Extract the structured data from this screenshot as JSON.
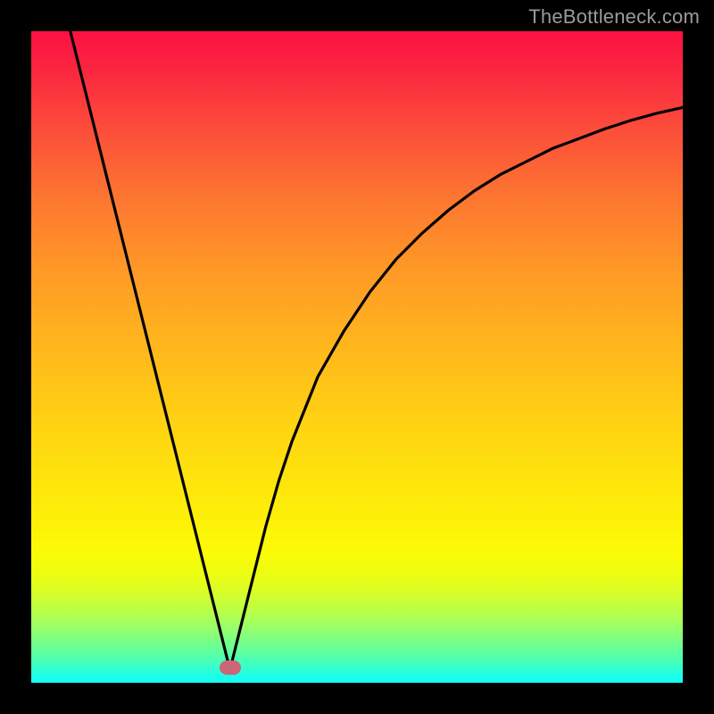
{
  "watermark": "TheBottleneck.com",
  "marker": {
    "x_pct": 30.5,
    "y_pct": 97.7,
    "color": "#cc6677"
  },
  "chart_data": {
    "type": "line",
    "title": "",
    "xlabel": "",
    "ylabel": "",
    "xlim": [
      0,
      100
    ],
    "ylim": [
      0,
      100
    ],
    "series": [
      {
        "name": "left-branch",
        "x": [
          6,
          8,
          10,
          12,
          14,
          16,
          18,
          20,
          22,
          24,
          26,
          28,
          30,
          30.5
        ],
        "y": [
          100,
          92,
          84,
          76,
          68,
          60,
          52,
          44,
          36,
          28,
          20,
          12,
          4,
          2
        ]
      },
      {
        "name": "right-branch",
        "x": [
          30.5,
          32,
          34,
          36,
          38,
          40,
          44,
          48,
          52,
          56,
          60,
          64,
          68,
          72,
          76,
          80,
          84,
          88,
          92,
          96,
          100
        ],
        "y": [
          2,
          8,
          16,
          24,
          31,
          37,
          47,
          54,
          60,
          65,
          69,
          72.5,
          75.5,
          78,
          80,
          82,
          83.5,
          85,
          86.3,
          87.4,
          88.3
        ]
      }
    ],
    "points": [
      {
        "name": "optimum-marker",
        "x": 30.5,
        "y": 2.3
      }
    ],
    "notes": "Background is a full-area vertical gradient from red (top) through orange/yellow to green/teal (bottom). Black frame border; no visible axis ticks or labels. Values are percentage coordinates estimated visually."
  }
}
